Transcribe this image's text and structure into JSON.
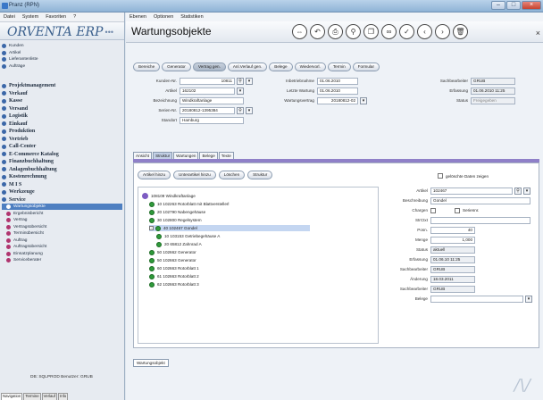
{
  "window": {
    "title": "Pranz (RPN)"
  },
  "sidebar": {
    "menu": [
      "Datei",
      "System",
      "Favoriten",
      "?"
    ],
    "logo": "ORVENTA ERP",
    "items": [
      {
        "label": "Kunden",
        "type": "item"
      },
      {
        "label": "Artikel",
        "type": "item"
      },
      {
        "label": "Lieferantenliste",
        "type": "item"
      },
      {
        "label": "Aufträge",
        "type": "item"
      },
      {
        "label": "Projektmanagement",
        "type": "section"
      },
      {
        "label": "Verkauf",
        "type": "section"
      },
      {
        "label": "Kasse",
        "type": "section"
      },
      {
        "label": "Versand",
        "type": "section"
      },
      {
        "label": "Logistik",
        "type": "section"
      },
      {
        "label": "Einkauf",
        "type": "section"
      },
      {
        "label": "Produktion",
        "type": "section"
      },
      {
        "label": "Vertrieb",
        "type": "section"
      },
      {
        "label": "Call-Center",
        "type": "section"
      },
      {
        "label": "E-Commerce Katalog",
        "type": "section"
      },
      {
        "label": "Finanzbuchhaltung",
        "type": "section"
      },
      {
        "label": "Anlagenbuchhaltung",
        "type": "section"
      },
      {
        "label": "Kostenrechnung",
        "type": "section"
      },
      {
        "label": "M I S",
        "type": "section"
      },
      {
        "label": "Werkzeuge",
        "type": "section"
      },
      {
        "label": "Service",
        "type": "section"
      },
      {
        "label": "Wartungsobjekte",
        "type": "sub",
        "selected": true
      },
      {
        "label": "Ergebnisbericht",
        "type": "sub"
      },
      {
        "label": "Vertrag",
        "type": "sub"
      },
      {
        "label": "Vertragsübersicht",
        "type": "sub"
      },
      {
        "label": "Terminübersicht",
        "type": "sub"
      },
      {
        "label": "Auftrag",
        "type": "sub"
      },
      {
        "label": "Auftragsübersicht",
        "type": "sub"
      },
      {
        "label": "Einsatzplanung",
        "type": "sub"
      },
      {
        "label": "Serviceberater",
        "type": "sub"
      }
    ],
    "status": "DB: SQLPROD Benutzer: GRUB",
    "tabs": [
      "Navigation",
      "Termine",
      "Verlauf",
      "Info"
    ]
  },
  "main": {
    "menu": [
      "Ebenen",
      "Optionen",
      "Statistiken"
    ],
    "title": "Wartungsobjekte",
    "toolbar_icons": [
      "link-icon",
      "undo-icon",
      "print-icon",
      "search-icon",
      "copy-icon",
      "glasses-icon",
      "check-icon",
      "back-icon",
      "forward-icon",
      "trash-icon"
    ],
    "close_glyph": "×",
    "buttons": [
      {
        "label": "Bereiche",
        "active": false
      },
      {
        "label": "Generator",
        "active": false
      },
      {
        "label": "Vertrag gen.",
        "active": true
      },
      {
        "label": "Anl.Verlauf gen.",
        "active": false
      },
      {
        "label": "Belege",
        "active": false
      },
      {
        "label": "Wiedervorl.",
        "active": false
      },
      {
        "label": "Termin",
        "active": false
      },
      {
        "label": "Formular",
        "active": false
      }
    ],
    "form": {
      "kundennr_label": "Kunden-Nr.",
      "kundennr": "10811",
      "artikel_label": "Artikel",
      "artikel": "162102",
      "bezeichnung_label": "Bezeichnung",
      "bezeichnung": "Windkraftanlage",
      "seriennr_label": "Serien-Nr.",
      "seriennr": "20180812-1395384",
      "standort_label": "Standort",
      "standort": "Hamburg",
      "inbetrieb_label": "Inbetriebnahme",
      "inbetrieb": "01.06.2010",
      "letzte_label": "Letzte Wartung",
      "letzte": "01.06.2010",
      "vertrag_label": "Wartungsvertrag",
      "vertrag": "20180812-02",
      "bearbeiter_label": "Sachbearbeiter",
      "bearbeiter": "GRUB",
      "erfassung_label": "Erfassung",
      "erfassung": "01.06.2010 11:25",
      "status_label": "Status",
      "status": "Freigegeben"
    },
    "tabs": [
      {
        "label": "Ansicht",
        "active": false
      },
      {
        "label": "Struktur",
        "active": true
      },
      {
        "label": "Wartungen",
        "active": false
      },
      {
        "label": "Belege",
        "active": false
      },
      {
        "label": "Texte",
        "active": false
      }
    ],
    "panel_buttons": [
      "Artikel hinzu",
      "Unterartikel hinzu",
      "Löschen",
      "Struktur"
    ],
    "show_deleted_label": "gelöschte Daten zeigen",
    "tree": [
      {
        "label": "108109 Windkraftanlage",
        "level": 0,
        "icon": "root"
      },
      {
        "label": "10 102263 Rotorblatt mit Blattverstellerl",
        "level": 1
      },
      {
        "label": "20 102790 Nabengehäuse",
        "level": 1
      },
      {
        "label": "30 102800 Regelsystem",
        "level": 1
      },
      {
        "label": "40 102467 Gondel",
        "level": 1,
        "selected": true,
        "expanded": true
      },
      {
        "label": "10 103153 Getriebegehäuse A",
        "level": 2
      },
      {
        "label": "20 65812 Zahnrad A",
        "level": 2
      },
      {
        "label": "50 102662 Generator",
        "level": 1
      },
      {
        "label": "50 102663 Generator",
        "level": 1
      },
      {
        "label": "60 102663 Rotorblatt 1",
        "level": 1
      },
      {
        "label": "61 102663 Rotorblatt 2",
        "level": 1
      },
      {
        "label": "62 102663 Rotorblatt 3",
        "level": 1
      }
    ],
    "props": {
      "artikel_label": "Artikel",
      "artikel": "102467",
      "bez_label": "Beschreibung",
      "bez": "Gondel",
      "chargen_label": "Chargen",
      "serien_label": "Seriennr.",
      "strnr_label": "StrCtxt",
      "pos_label": "Posn.",
      "pos": "40",
      "menge_label": "Menge",
      "menge": "1,000",
      "status_label": "Status",
      "status": "aktuell",
      "erfassung_label": "Erfassung",
      "erfassung": "01.06.10 11:25",
      "sb_label": "Sachbearbeiter",
      "sb": "GRUB",
      "aenderung_label": "Änderung",
      "aenderung": "18.03.2011",
      "sb2_label": "Sachbearbeiter",
      "sb2": "GRUB",
      "beleg_label": "Belege"
    },
    "bottom_tab": "Wartungsobjekt",
    "watermark": "/\\/"
  }
}
